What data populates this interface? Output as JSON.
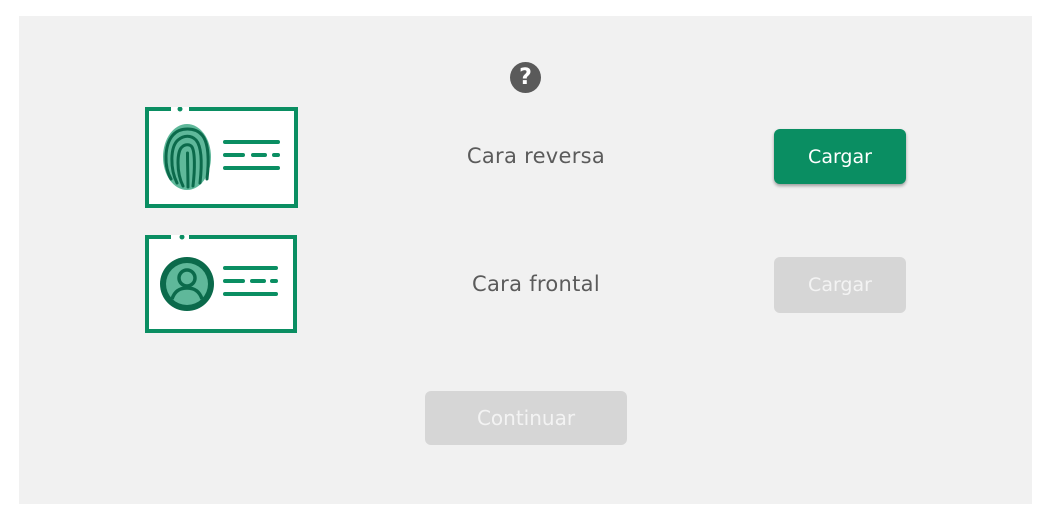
{
  "help": {
    "glyph": "?",
    "icon": "question-circle-icon"
  },
  "rows": [
    {
      "label": "Cara reversa",
      "icon": "id-card-fingerprint-icon",
      "button": {
        "label": "Cargar",
        "state": "enabled"
      }
    },
    {
      "label": "Cara frontal",
      "icon": "id-card-person-icon",
      "button": {
        "label": "Cargar",
        "state": "disabled"
      }
    }
  ],
  "continue_button": {
    "label": "Continuar",
    "state": "disabled"
  },
  "colors": {
    "accent": "#0a8e62",
    "icon_light": "#5fb89a",
    "icon_dark": "#0b6a4b",
    "disabled": "#d6d6d6",
    "panel": "#f1f1f1"
  }
}
